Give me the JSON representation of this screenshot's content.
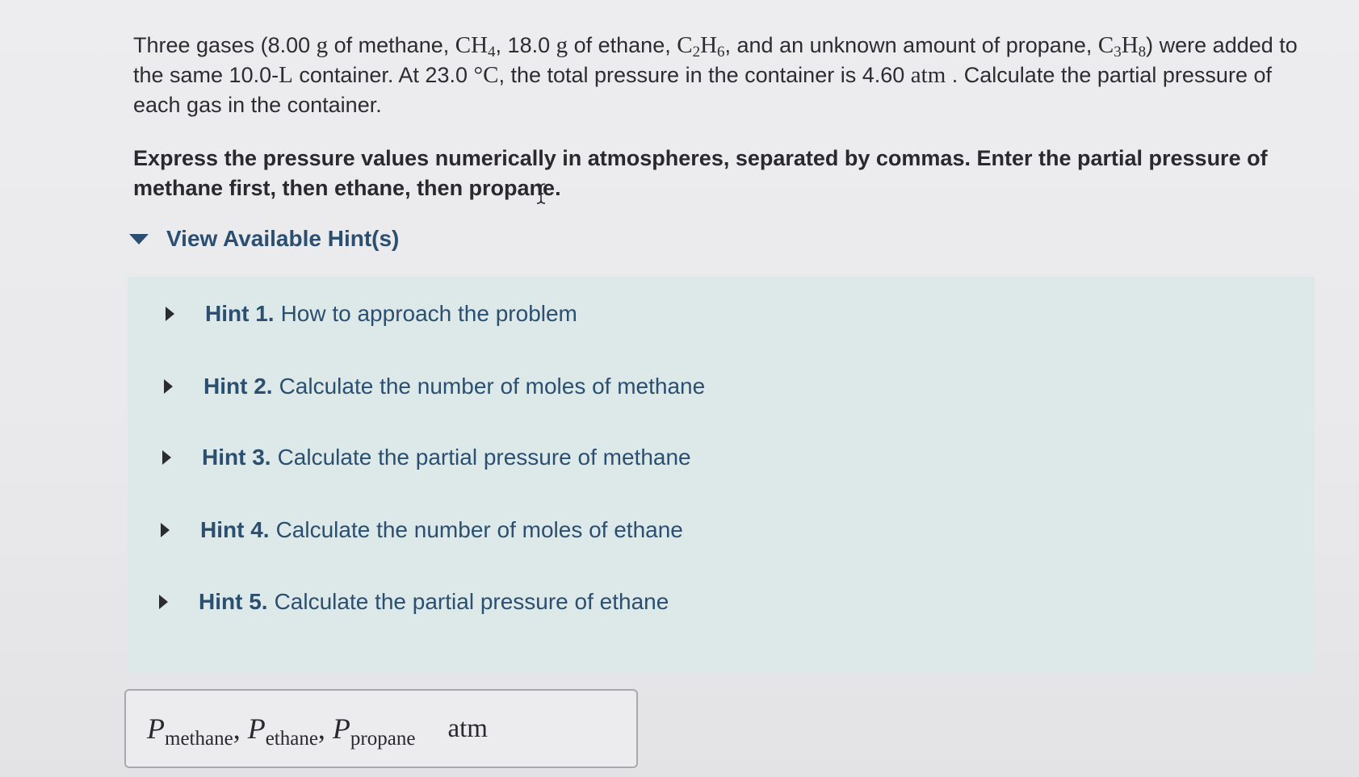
{
  "question": {
    "t1": "Three gases (8.00 ",
    "g1": "g",
    "t2": " of methane, ",
    "ch": "CH",
    "ch_sub": "4",
    "t3": ", 18.0 ",
    "g2": "g",
    "t4": " of ethane, ",
    "c2": "C",
    "c2_sub": "2",
    "h6": "H",
    "h6_sub": "6",
    "t5": ", and an unknown amount of propane, ",
    "c3": "C",
    "c3_sub": "3",
    "h8": "H",
    "h8_sub": "8",
    "t6": ") were added to the same 10.0-",
    "L": "L",
    "t7": " container. At 23.0 ",
    "degC": "°C",
    "t8": ", the total pressure in the container is 4.60 ",
    "atm": "atm",
    "t9": " . Calculate the partial pressure of each gas in the container."
  },
  "instruction": "Express the pressure values numerically in atmospheres, separated by commas. Enter the partial pressure of methane first, then ethane, then propane.",
  "hints_toggle": {
    "label": "View Available Hint(s)",
    "icon": "caret-down-icon"
  },
  "hints": [
    {
      "number": "Hint 1.",
      "text": "How to approach the problem"
    },
    {
      "number": "Hint 2.",
      "text": "Calculate the number of moles of methane"
    },
    {
      "number": "Hint 3.",
      "text": "Calculate the partial pressure of methane"
    },
    {
      "number": "Hint 4.",
      "text": "Calculate the number of moles of ethane"
    },
    {
      "number": "Hint 5.",
      "text": "Calculate the partial pressure of ethane"
    }
  ],
  "answer": {
    "p": "P",
    "sub_methane": "methane",
    "sep": ", ",
    "sub_ethane": "ethane",
    "sub_propane": "propane",
    "unit": "atm"
  }
}
